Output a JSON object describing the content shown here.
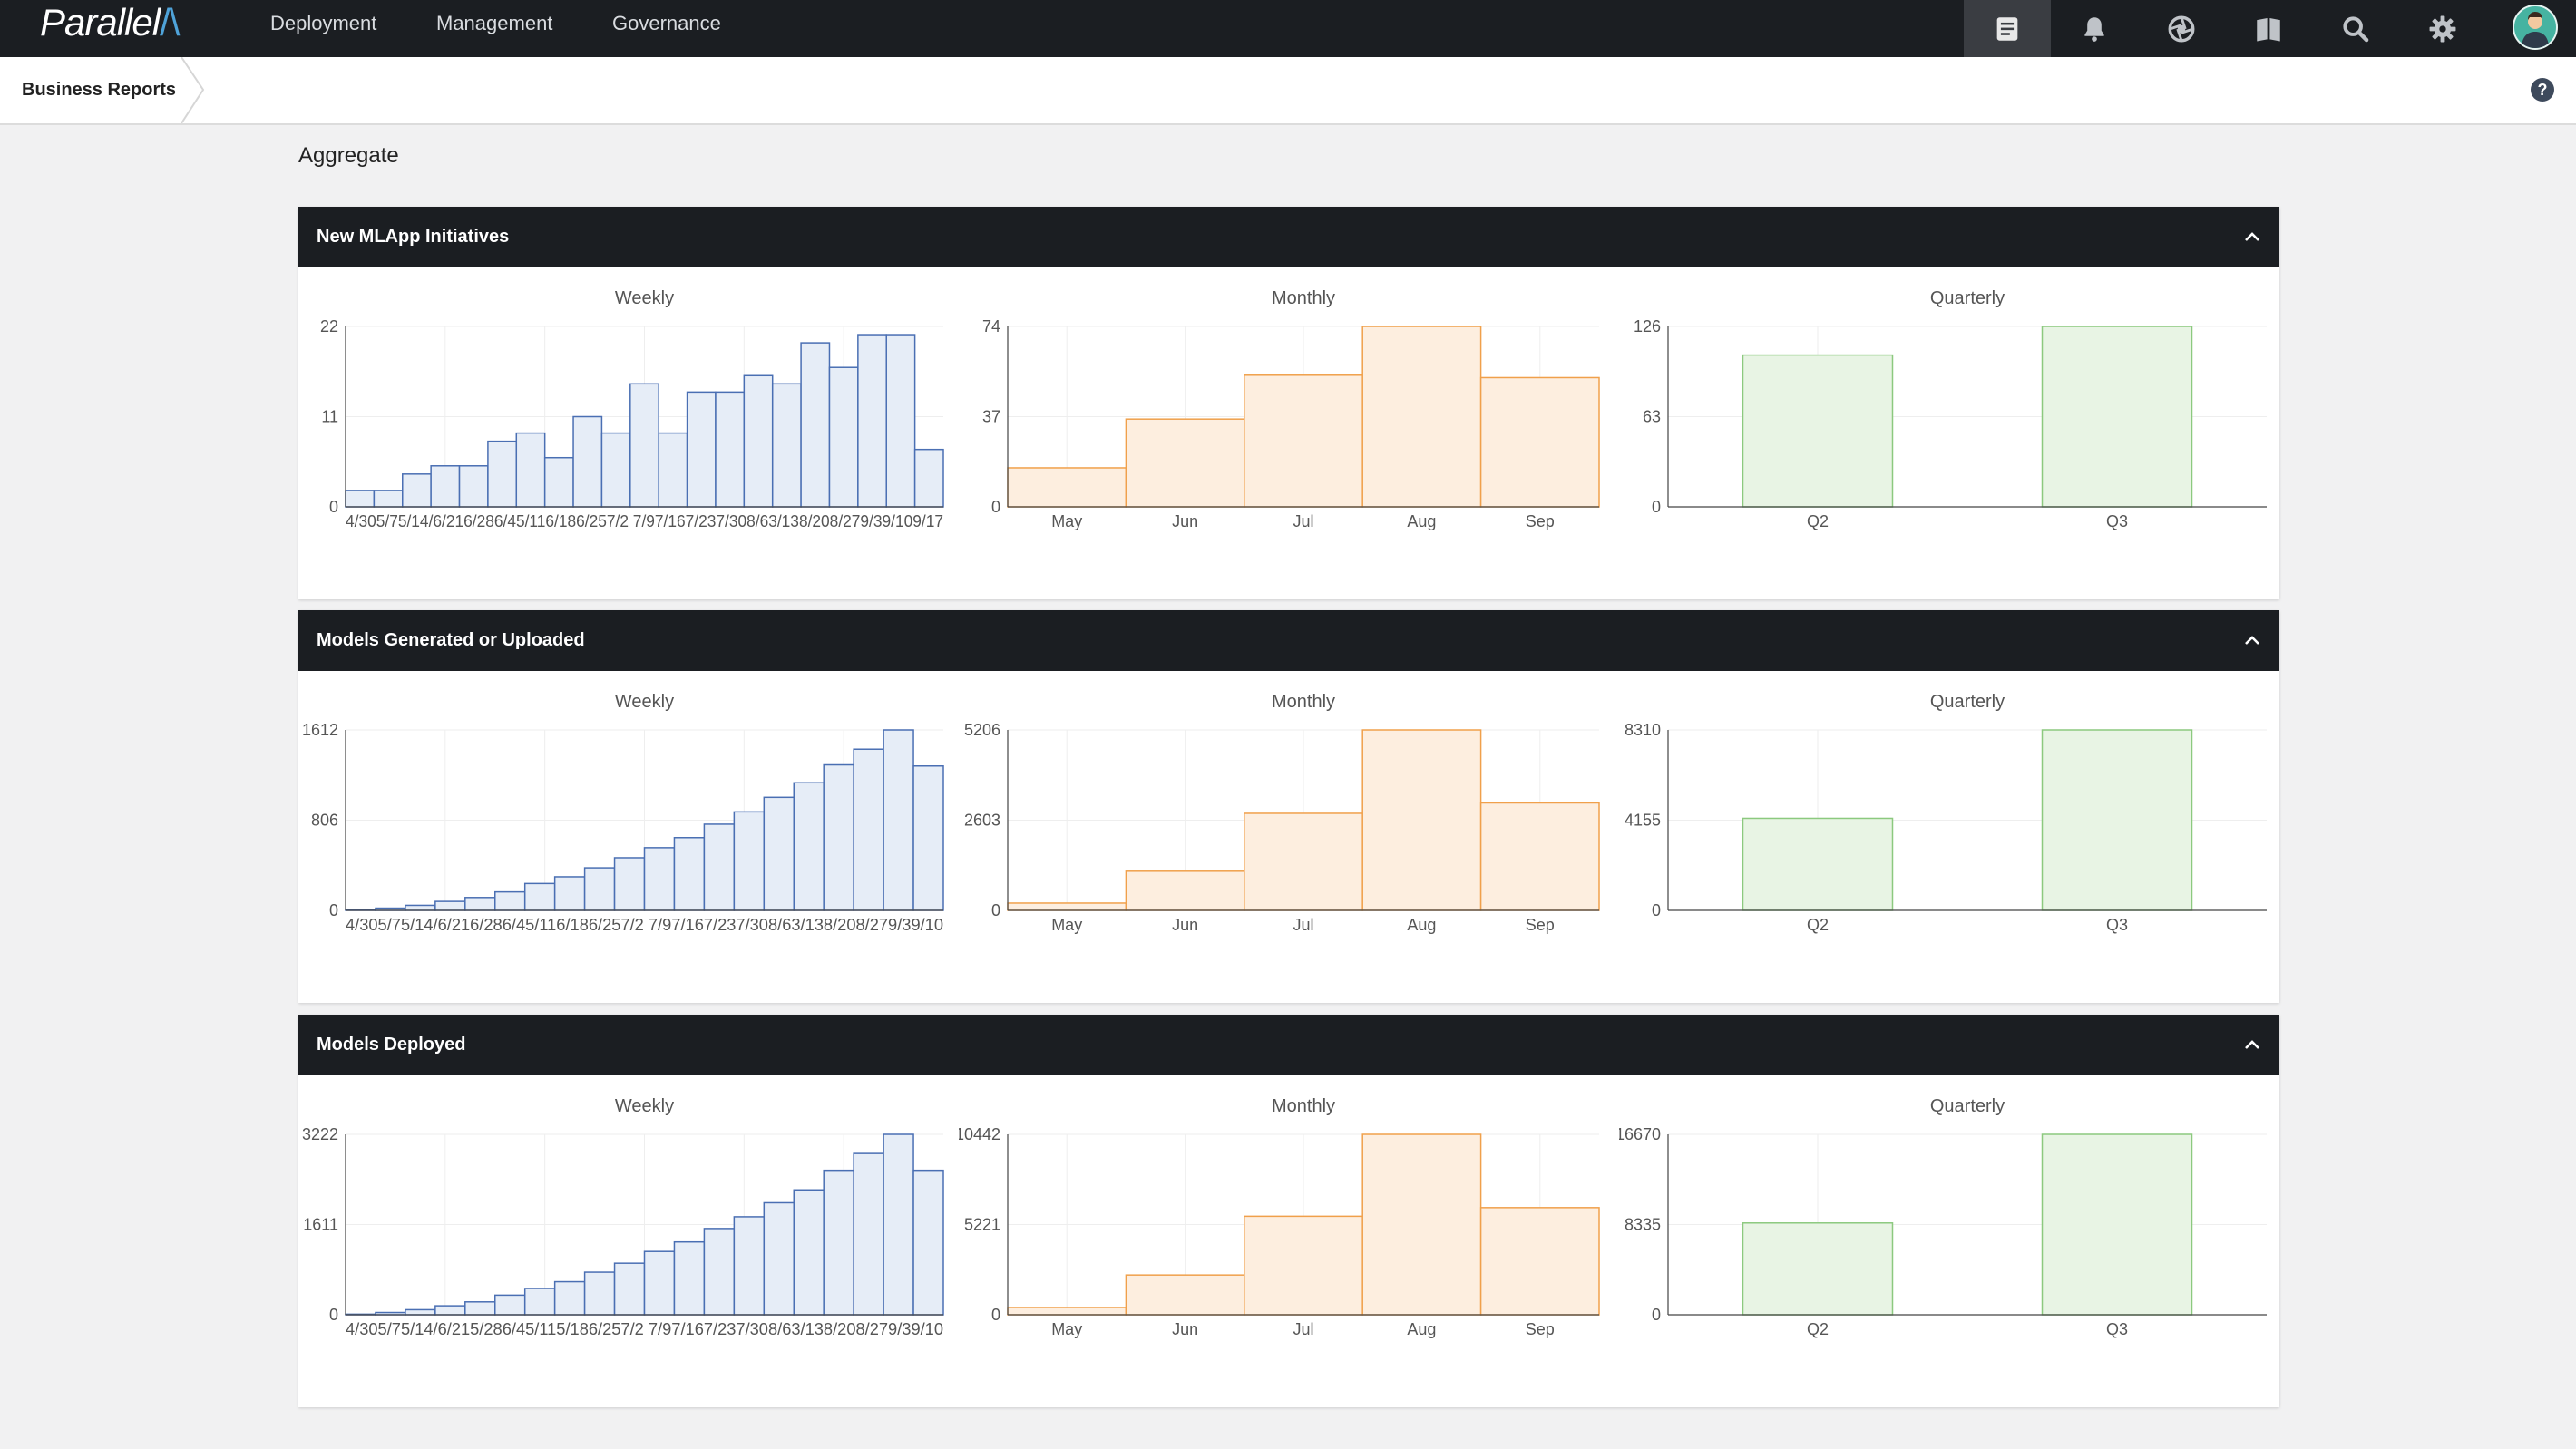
{
  "app": {
    "logo_text": "Parallel",
    "logo_mark": "/\\",
    "nav": [
      "Deployment",
      "Management",
      "Governance"
    ],
    "icons": [
      "reports-icon",
      "bell-icon",
      "aperture-icon",
      "book-icon",
      "search-icon",
      "gear-icon"
    ]
  },
  "breadcrumb": {
    "label": "Business Reports",
    "help": "?"
  },
  "section_title": "Aggregate",
  "colors": {
    "weekly_fill": "#e6edf7",
    "weekly_line": "#4a6fb3",
    "monthly_fill": "#fdeedf",
    "monthly_line": "#f0a04b",
    "quarterly_fill": "#e8f4e4",
    "quarterly_line": "#8cc97f"
  },
  "panels": [
    {
      "title": "New MLApp Initiatives",
      "chart_data": [
        {
          "type": "bar",
          "title": "Weekly",
          "ylim": [
            0,
            22
          ],
          "yticks": [
            "0",
            "11",
            "22"
          ],
          "categories": [
            "4/30",
            "5/7",
            "5/14",
            "5/21",
            "5/28",
            "6/4",
            "6/11",
            "6/18",
            "6/25",
            "7/2",
            "7/9",
            "7/16",
            "7/23",
            "7/30",
            "8/6",
            "8/13",
            "8/20",
            "8/27",
            "9/3",
            "9/10",
            "9/17"
          ],
          "xtick_text": "4/305/75/14/6/216/286/45/116/186/257/2 7/97/167/237/308/63/138/208/279/39/109/17",
          "values": [
            2,
            2,
            4,
            5,
            5,
            8,
            9,
            6,
            11,
            9,
            15,
            9,
            14,
            14,
            16,
            15,
            20,
            17,
            21,
            21,
            7
          ]
        },
        {
          "type": "bar",
          "title": "Monthly",
          "ylim": [
            0,
            74
          ],
          "yticks": [
            "0",
            "37",
            "74"
          ],
          "categories": [
            "May",
            "Jun",
            "Jul",
            "Aug",
            "Sep"
          ],
          "values": [
            16,
            36,
            54,
            74,
            53
          ]
        },
        {
          "type": "bar",
          "title": "Quarterly",
          "ylim": [
            0,
            126
          ],
          "yticks": [
            "0",
            "63",
            "126"
          ],
          "categories": [
            "Q2",
            "Q3"
          ],
          "values": [
            106,
            126
          ]
        }
      ]
    },
    {
      "title": "Models Generated or Uploaded",
      "chart_data": [
        {
          "type": "bar",
          "title": "Weekly",
          "ylim": [
            0,
            1612
          ],
          "yticks": [
            "0",
            "806",
            "1612"
          ],
          "categories": [
            "4/30",
            "5/7",
            "5/14",
            "5/21",
            "5/28",
            "6/4",
            "6/11",
            "6/18",
            "6/25",
            "7/2",
            "7/9",
            "7/16",
            "7/23",
            "7/30",
            "8/6",
            "8/13",
            "8/20",
            "8/27",
            "9/3",
            "9/10"
          ],
          "xtick_text": "4/305/75/14/6/216/286/45/116/186/257/2 7/97/167/237/308/63/138/208/279/39/10",
          "values": [
            5,
            20,
            45,
            80,
            115,
            165,
            240,
            300,
            380,
            470,
            560,
            650,
            770,
            880,
            1010,
            1140,
            1300,
            1440,
            1612,
            1290
          ]
        },
        {
          "type": "bar",
          "title": "Monthly",
          "ylim": [
            0,
            5206
          ],
          "yticks": [
            "0",
            "2603",
            "5206"
          ],
          "categories": [
            "May",
            "Jun",
            "Jul",
            "Aug",
            "Sep"
          ],
          "values": [
            210,
            1130,
            2800,
            5206,
            3100
          ]
        },
        {
          "type": "bar",
          "title": "Quarterly",
          "ylim": [
            0,
            8310
          ],
          "yticks": [
            "0",
            "4155",
            "8310"
          ],
          "categories": [
            "Q2",
            "Q3"
          ],
          "values": [
            4240,
            8310
          ]
        }
      ]
    },
    {
      "title": "Models Deployed",
      "chart_data": [
        {
          "type": "bar",
          "title": "Weekly",
          "ylim": [
            0,
            3222
          ],
          "yticks": [
            "0",
            "1611",
            "3222"
          ],
          "categories": [
            "4/30",
            "5/7",
            "5/14",
            "5/21",
            "5/28",
            "6/4",
            "6/11",
            "6/18",
            "6/25",
            "7/2",
            "7/9",
            "7/16",
            "7/23",
            "7/30",
            "8/6",
            "8/13",
            "8/20",
            "8/27",
            "9/3",
            "9/10"
          ],
          "xtick_text": "4/305/75/14/6/215/286/45/115/186/257/2 7/97/167/237/308/63/138/208/279/39/10",
          "values": [
            10,
            40,
            90,
            160,
            230,
            350,
            470,
            590,
            760,
            920,
            1130,
            1300,
            1540,
            1750,
            2000,
            2230,
            2580,
            2880,
            3222,
            2580
          ]
        },
        {
          "type": "bar",
          "title": "Monthly",
          "ylim": [
            0,
            10442
          ],
          "yticks": [
            "0",
            "5221",
            "10442"
          ],
          "categories": [
            "May",
            "Jun",
            "Jul",
            "Aug",
            "Sep"
          ],
          "values": [
            420,
            2300,
            5700,
            10442,
            6200
          ]
        },
        {
          "type": "bar",
          "title": "Quarterly",
          "ylim": [
            0,
            16670
          ],
          "yticks": [
            "0",
            "8335",
            "16670"
          ],
          "categories": [
            "Q2",
            "Q3"
          ],
          "values": [
            8480,
            16670
          ]
        }
      ]
    }
  ]
}
